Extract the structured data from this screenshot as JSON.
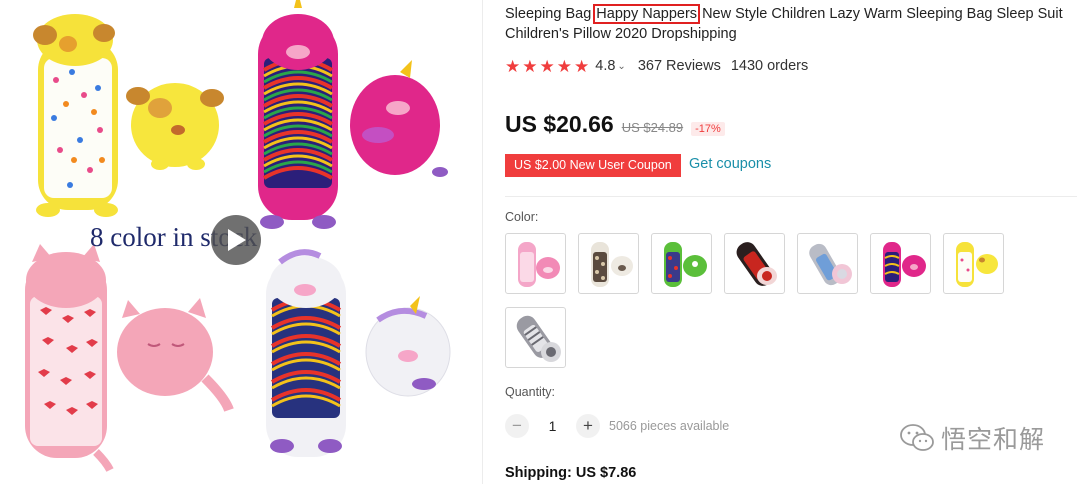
{
  "gallery": {
    "overlay_text": "8 color in stock",
    "play_icon": "play-icon"
  },
  "product": {
    "title_before": "Sleeping Bag ",
    "title_highlight": "Happy Nappers",
    "title_after": " New Style Children Lazy Warm Sleeping Bag Sleep Suit Children's Pillow 2020 Dropshipping",
    "rating": "4.8",
    "rating_chevron": "⌄",
    "reviews": "367 Reviews",
    "orders": "1430 orders",
    "stars": 5
  },
  "pricing": {
    "price": "US $20.66",
    "old_price": "US $24.89",
    "discount": "-17%",
    "coupon": "US $2.00 New User Coupon",
    "get_coupons": "Get coupons"
  },
  "options": {
    "color_label": "Color:",
    "color_swatches": [
      "pink-pig",
      "leopard",
      "green-monster",
      "black-red-bird",
      "grey-blue",
      "rainbow-unicorn",
      "yellow-dog",
      "grey-raccoon"
    ],
    "quantity_label": "Quantity:",
    "quantity_minus": "−",
    "quantity_plus": "+",
    "quantity": "1",
    "available": "5066 pieces available"
  },
  "shipping": {
    "text": "Shipping: US $7.86"
  },
  "watermark": {
    "text": "悟空和解",
    "icon": "wechat-icon"
  },
  "colors": {
    "accent_red": "#f03d3d",
    "link_teal": "#1a8fa9",
    "highlight_box": "#e02020"
  }
}
